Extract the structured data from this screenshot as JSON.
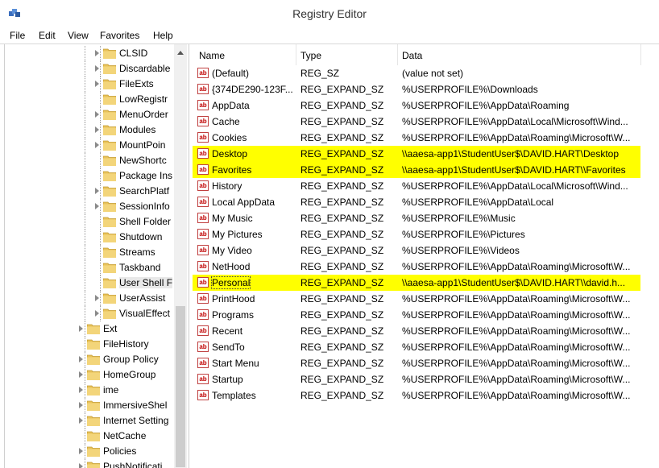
{
  "window": {
    "title": "Registry Editor"
  },
  "menu": [
    "File",
    "Edit",
    "View",
    "Favorites",
    "Help"
  ],
  "tree": [
    {
      "label": "CLSID",
      "expander": true,
      "depth": 2
    },
    {
      "label": "Discardable",
      "expander": true,
      "depth": 2
    },
    {
      "label": "FileExts",
      "expander": true,
      "depth": 2
    },
    {
      "label": "LowRegistr",
      "expander": false,
      "depth": 2
    },
    {
      "label": "MenuOrder",
      "expander": true,
      "depth": 2
    },
    {
      "label": "Modules",
      "expander": true,
      "depth": 2
    },
    {
      "label": "MountPoin",
      "expander": true,
      "depth": 2
    },
    {
      "label": "NewShortc",
      "expander": false,
      "depth": 2
    },
    {
      "label": "Package Ins",
      "expander": false,
      "depth": 2
    },
    {
      "label": "SearchPlatf",
      "expander": true,
      "depth": 2
    },
    {
      "label": "SessionInfo",
      "expander": true,
      "depth": 2
    },
    {
      "label": "Shell Folder",
      "expander": false,
      "depth": 2
    },
    {
      "label": "Shutdown",
      "expander": false,
      "depth": 2
    },
    {
      "label": "Streams",
      "expander": false,
      "depth": 2
    },
    {
      "label": "Taskband",
      "expander": false,
      "depth": 2
    },
    {
      "label": "User Shell F",
      "expander": false,
      "depth": 2,
      "selected": true
    },
    {
      "label": "UserAssist",
      "expander": true,
      "depth": 2
    },
    {
      "label": "VisualEffect",
      "expander": true,
      "depth": 2
    },
    {
      "label": "Ext",
      "expander": true,
      "depth": 1
    },
    {
      "label": "FileHistory",
      "expander": false,
      "depth": 1
    },
    {
      "label": "Group Policy",
      "expander": true,
      "depth": 1
    },
    {
      "label": "HomeGroup",
      "expander": true,
      "depth": 1
    },
    {
      "label": "ime",
      "expander": true,
      "depth": 1
    },
    {
      "label": "ImmersiveShel",
      "expander": true,
      "depth": 1
    },
    {
      "label": "Internet Setting",
      "expander": true,
      "depth": 1
    },
    {
      "label": "NetCache",
      "expander": false,
      "depth": 1
    },
    {
      "label": "Policies",
      "expander": true,
      "depth": 1
    },
    {
      "label": "PushNotificati",
      "expander": true,
      "depth": 1
    }
  ],
  "columns": [
    "Name",
    "Type",
    "Data"
  ],
  "values": [
    {
      "icon": "ab",
      "name": "(Default)",
      "type": "REG_SZ",
      "data": "(value not set)"
    },
    {
      "icon": "ab",
      "name": "{374DE290-123F...",
      "type": "REG_EXPAND_SZ",
      "data": "%USERPROFILE%\\Downloads"
    },
    {
      "icon": "ab",
      "name": "AppData",
      "type": "REG_EXPAND_SZ",
      "data": "%USERPROFILE%\\AppData\\Roaming"
    },
    {
      "icon": "ab",
      "name": "Cache",
      "type": "REG_EXPAND_SZ",
      "data": "%USERPROFILE%\\AppData\\Local\\Microsoft\\Wind..."
    },
    {
      "icon": "ab",
      "name": "Cookies",
      "type": "REG_EXPAND_SZ",
      "data": "%USERPROFILE%\\AppData\\Roaming\\Microsoft\\W..."
    },
    {
      "icon": "ab",
      "name": "Desktop",
      "type": "REG_EXPAND_SZ",
      "data": "\\\\aaesa-app1\\StudentUser$\\DAVID.HART\\Desktop",
      "highlight": true
    },
    {
      "icon": "ab",
      "name": "Favorites",
      "type": "REG_EXPAND_SZ",
      "data": "\\\\aaesa-app1\\StudentUser$\\DAVID.HART\\\\Favorites",
      "highlight": true
    },
    {
      "icon": "ab",
      "name": "History",
      "type": "REG_EXPAND_SZ",
      "data": "%USERPROFILE%\\AppData\\Local\\Microsoft\\Wind..."
    },
    {
      "icon": "ab",
      "name": "Local AppData",
      "type": "REG_EXPAND_SZ",
      "data": "%USERPROFILE%\\AppData\\Local"
    },
    {
      "icon": "ab",
      "name": "My Music",
      "type": "REG_EXPAND_SZ",
      "data": "%USERPROFILE%\\Music"
    },
    {
      "icon": "ab",
      "name": "My Pictures",
      "type": "REG_EXPAND_SZ",
      "data": "%USERPROFILE%\\Pictures"
    },
    {
      "icon": "ab",
      "name": "My Video",
      "type": "REG_EXPAND_SZ",
      "data": "%USERPROFILE%\\Videos"
    },
    {
      "icon": "ab",
      "name": "NetHood",
      "type": "REG_EXPAND_SZ",
      "data": "%USERPROFILE%\\AppData\\Roaming\\Microsoft\\W..."
    },
    {
      "icon": "ab",
      "name": "Personal",
      "type": "REG_EXPAND_SZ",
      "data": "\\\\aaesa-app1\\StudentUser$\\DAVID.HART\\\\david.h...",
      "highlight": true,
      "focused": true
    },
    {
      "icon": "ab",
      "name": "PrintHood",
      "type": "REG_EXPAND_SZ",
      "data": "%USERPROFILE%\\AppData\\Roaming\\Microsoft\\W..."
    },
    {
      "icon": "ab",
      "name": "Programs",
      "type": "REG_EXPAND_SZ",
      "data": "%USERPROFILE%\\AppData\\Roaming\\Microsoft\\W..."
    },
    {
      "icon": "ab",
      "name": "Recent",
      "type": "REG_EXPAND_SZ",
      "data": "%USERPROFILE%\\AppData\\Roaming\\Microsoft\\W..."
    },
    {
      "icon": "ab",
      "name": "SendTo",
      "type": "REG_EXPAND_SZ",
      "data": "%USERPROFILE%\\AppData\\Roaming\\Microsoft\\W..."
    },
    {
      "icon": "ab",
      "name": "Start Menu",
      "type": "REG_EXPAND_SZ",
      "data": "%USERPROFILE%\\AppData\\Roaming\\Microsoft\\W..."
    },
    {
      "icon": "ab",
      "name": "Startup",
      "type": "REG_EXPAND_SZ",
      "data": "%USERPROFILE%\\AppData\\Roaming\\Microsoft\\W..."
    },
    {
      "icon": "ab",
      "name": "Templates",
      "type": "REG_EXPAND_SZ",
      "data": "%USERPROFILE%\\AppData\\Roaming\\Microsoft\\W..."
    }
  ],
  "colors": {
    "highlight": "#ffff00",
    "folder": "#e8c25a"
  }
}
